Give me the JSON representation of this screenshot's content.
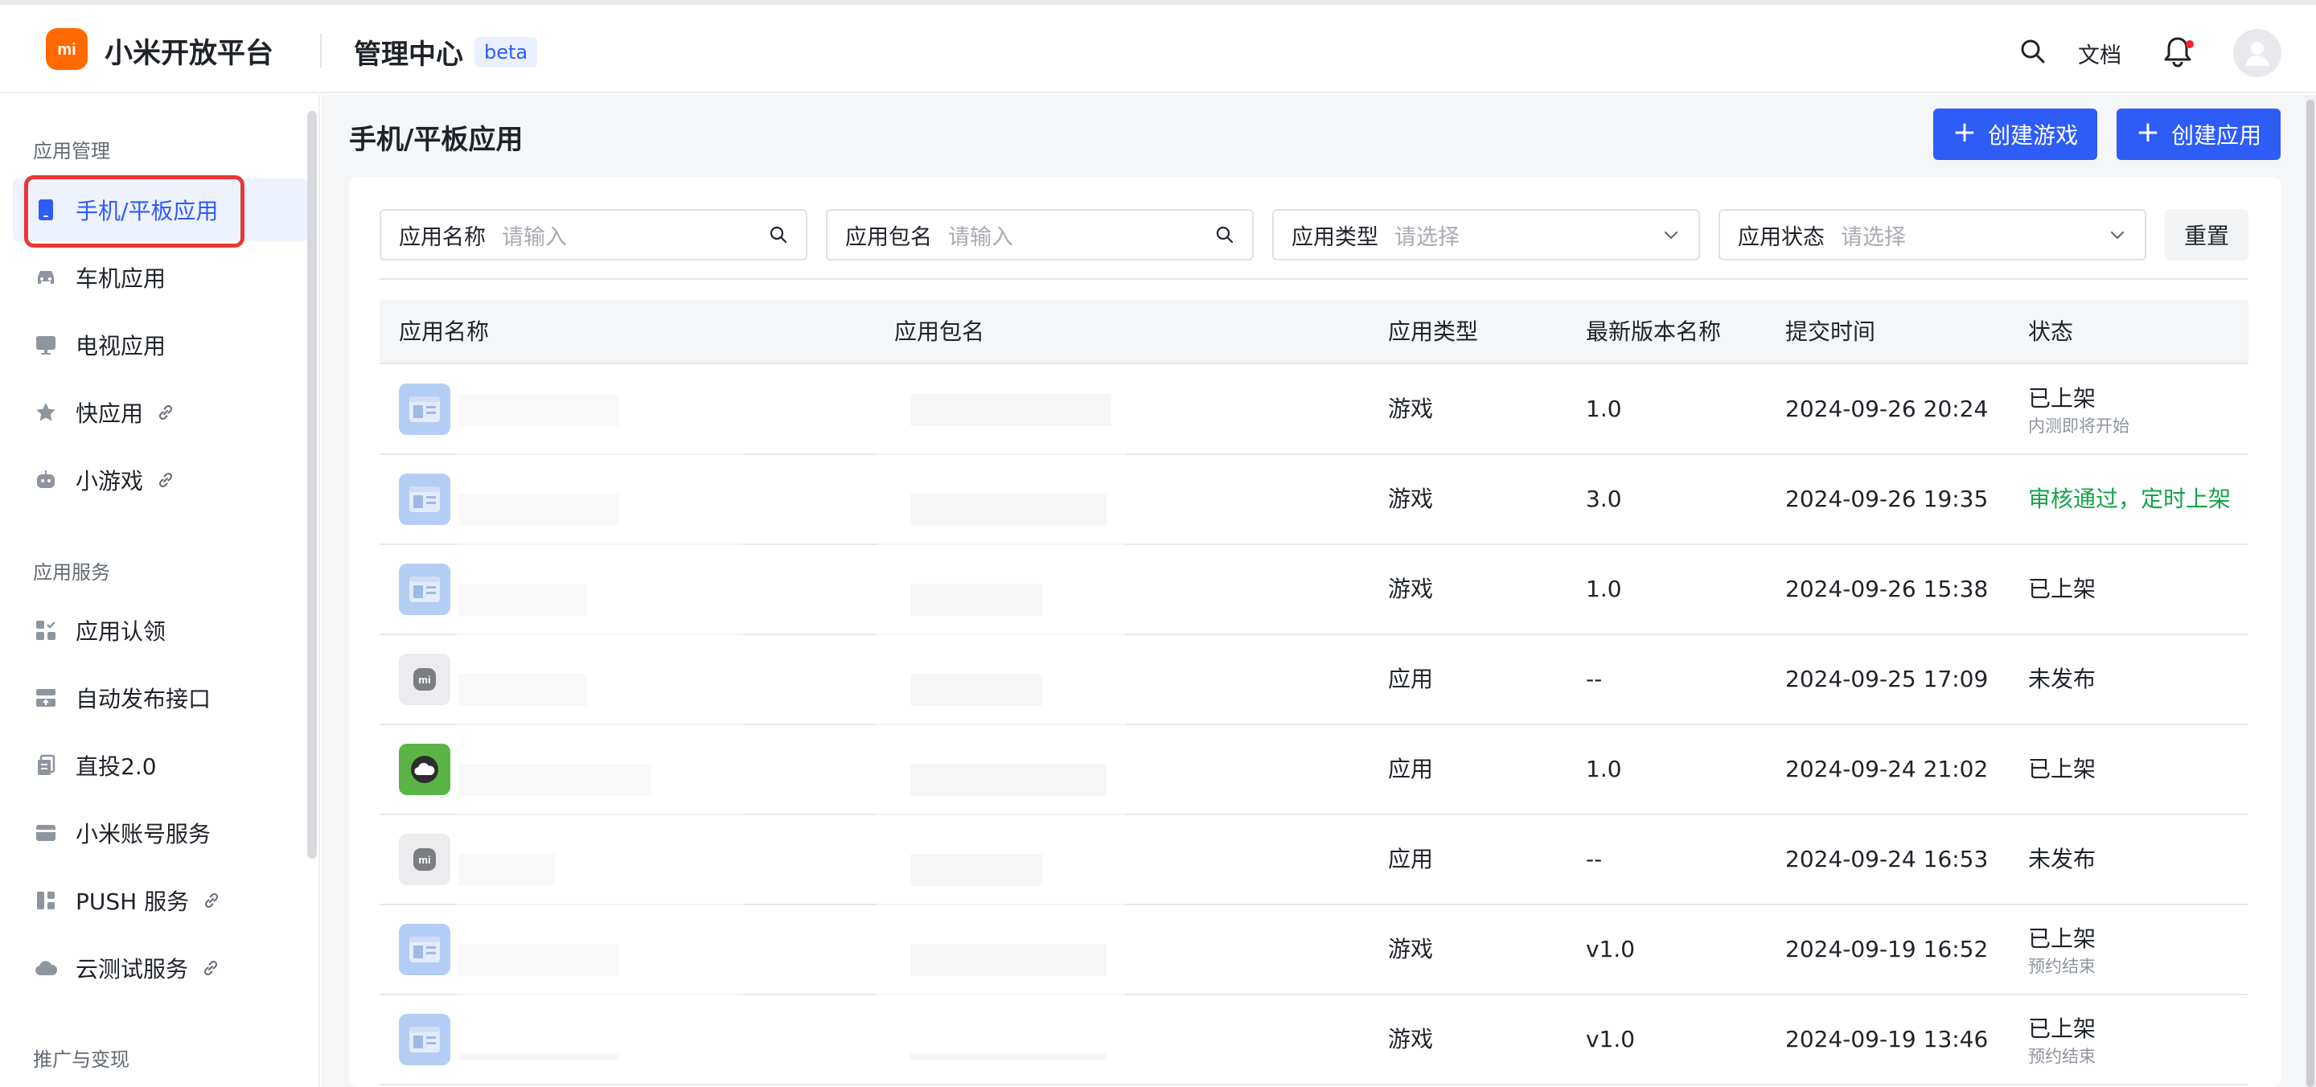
{
  "topbar": {
    "brand": "小米开放平台",
    "logo_text": "mi",
    "center_title": "管理中心",
    "badge": "beta",
    "docs": "文档"
  },
  "sidebar": {
    "groups": [
      {
        "title": "应用管理"
      },
      {
        "title": "应用服务"
      },
      {
        "title": "推广与变现"
      }
    ],
    "items": [
      {
        "label": "手机/平板应用",
        "icon": "phone-icon",
        "active": true
      },
      {
        "label": "车机应用",
        "icon": "car-icon"
      },
      {
        "label": "电视应用",
        "icon": "tv-icon"
      },
      {
        "label": "快应用",
        "icon": "star-icon",
        "external": true
      },
      {
        "label": "小游戏",
        "icon": "robot-icon",
        "external": true
      },
      {
        "label": "应用认领",
        "icon": "claim-icon"
      },
      {
        "label": "自动发布接口",
        "icon": "publish-icon"
      },
      {
        "label": "直投2.0",
        "icon": "copy-icon"
      },
      {
        "label": "小米账号服务",
        "icon": "account-icon"
      },
      {
        "label": "PUSH 服务",
        "icon": "push-icon",
        "external": true
      },
      {
        "label": "云测试服务",
        "icon": "cloud-icon",
        "external": true
      }
    ]
  },
  "main": {
    "title": "手机/平板应用",
    "buttons": {
      "create_game": "创建游戏",
      "create_app": "创建应用",
      "reset": "重置"
    },
    "filters": [
      {
        "label": "应用名称",
        "placeholder": "请输入"
      },
      {
        "label": "应用包名",
        "placeholder": "请输入"
      },
      {
        "label": "应用类型",
        "placeholder": "请选择"
      },
      {
        "label": "应用状态",
        "placeholder": "请选择"
      }
    ],
    "table": {
      "columns": [
        "应用名称",
        "应用包名",
        "应用类型",
        "最新版本名称",
        "提交时间",
        "状态"
      ],
      "rows": [
        {
          "icon": "game-icon",
          "type": "游戏",
          "version": "1.0",
          "time": "2024-09-26 20:24",
          "status": "已上架",
          "status_sub": "内测即将开始"
        },
        {
          "icon": "game-icon",
          "type": "游戏",
          "version": "3.0",
          "time": "2024-09-26 19:35",
          "status": "审核通过，定时上架",
          "status_color": "#16a34a"
        },
        {
          "icon": "game-icon",
          "type": "游戏",
          "version": "1.0",
          "time": "2024-09-26 15:38",
          "status": "已上架"
        },
        {
          "icon": "mi-icon",
          "type": "应用",
          "version": "--",
          "time": "2024-09-25 17:09",
          "status": "未发布"
        },
        {
          "icon": "weather-icon",
          "type": "应用",
          "version": "1.0",
          "time": "2024-09-24 21:02",
          "status": "已上架"
        },
        {
          "icon": "mi-icon",
          "type": "应用",
          "version": "--",
          "time": "2024-09-24 16:53",
          "status": "未发布"
        },
        {
          "icon": "game-icon",
          "type": "游戏",
          "version": "v1.0",
          "time": "2024-09-19 16:52",
          "status": "已上架",
          "status_sub": "预约结束"
        },
        {
          "icon": "game-icon",
          "type": "游戏",
          "version": "v1.0",
          "time": "2024-09-19 13:46",
          "status": "已上架",
          "status_sub": "预约结束"
        }
      ]
    }
  },
  "colors": {
    "accent": "#2d5cf6",
    "brand": "#ff6900",
    "success": "#16a34a",
    "highlight_frame": "#e53935"
  }
}
